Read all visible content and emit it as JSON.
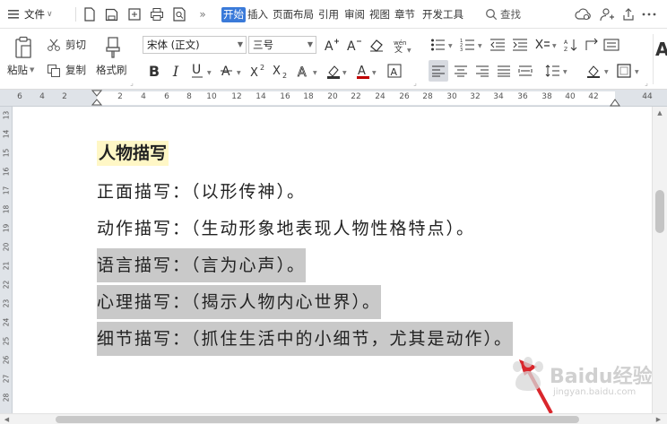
{
  "menubar": {
    "file_label": "文件",
    "tabs": [
      {
        "label": "开始",
        "active": true
      },
      {
        "label": "插入",
        "active": false
      },
      {
        "label": "页面布局",
        "active": false
      },
      {
        "label": "引用",
        "active": false
      },
      {
        "label": "审阅",
        "active": false
      },
      {
        "label": "视图",
        "active": false
      },
      {
        "label": "章节",
        "active": false
      },
      {
        "label": "开发工具",
        "active": false
      }
    ],
    "search_label": "查找"
  },
  "ribbon": {
    "paste_label": "粘贴",
    "cut_label": "剪切",
    "copy_label": "复制",
    "format_painter_label": "格式刷",
    "font_name": "宋体 (正文)",
    "font_size": "三号",
    "large_a_label": "A"
  },
  "ruler": {
    "numbers": [
      "6",
      "4",
      "2",
      "2",
      "4",
      "6",
      "8",
      "10",
      "12",
      "14",
      "16",
      "18",
      "20",
      "22",
      "24",
      "26",
      "28",
      "30",
      "32",
      "34",
      "36",
      "38",
      "40",
      "42",
      "44"
    ]
  },
  "vruler": {
    "numbers": [
      "13",
      "14",
      "15",
      "16",
      "17",
      "18",
      "19",
      "20",
      "21",
      "22",
      "23",
      "24",
      "25",
      "26",
      "27",
      "28"
    ]
  },
  "document": {
    "title": "人物描写",
    "lines": [
      {
        "text": "正面描写：（以形传神）。",
        "highlighted": false
      },
      {
        "text": "动作描写：（生动形象地表现人物性格特点）。",
        "highlighted": false
      },
      {
        "text": "语言描写：（言为心声）。",
        "highlighted": true
      },
      {
        "text": "心理描写：（揭示人物内心世界）。",
        "highlighted": true
      },
      {
        "text": "细节描写：（抓住生活中的小细节，尤其是动作）。",
        "highlighted": true
      }
    ]
  },
  "watermark": {
    "text": "Baidu经验",
    "sub": "jingyan.baidu.com"
  },
  "colors": {
    "accent": "#3a7ad9",
    "highlight": "#c9c9c9",
    "title_bg": "#fff7c6",
    "arrow": "#d9262c"
  }
}
